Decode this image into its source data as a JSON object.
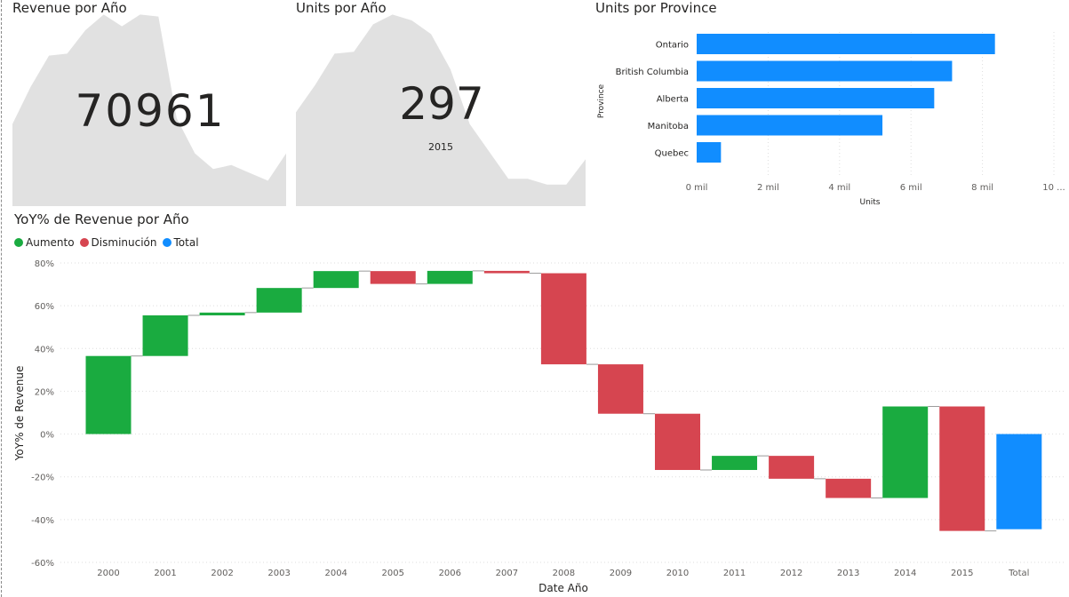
{
  "colors": {
    "increase": "#1aab40",
    "decrease": "#d64550",
    "total": "#118dff",
    "bar": "#118dff",
    "sparkline_fill": "#e1e1e1",
    "grid": "#dedede",
    "text": "#252423",
    "axis_text": "#605e5c"
  },
  "card_revenue": {
    "title": "Revenue por Año",
    "value": "70961"
  },
  "card_units": {
    "title": "Units por Año",
    "value": "297",
    "tooltip_year": "2015"
  },
  "units_by_province": {
    "title": "Units por Province"
  },
  "waterfall": {
    "title": "YoY% de Revenue por Año",
    "legend": [
      "Aumento",
      "Disminución",
      "Total"
    ]
  },
  "chart_data": [
    {
      "type": "area",
      "name": "revenue-sparkline",
      "title": "Revenue por Año",
      "x": [
        2000,
        2001,
        2002,
        2003,
        2004,
        2005,
        2006,
        2007,
        2008,
        2009,
        2010,
        2011,
        2012,
        2013,
        2014,
        2015
      ],
      "values": [
        0.42,
        0.61,
        0.77,
        0.78,
        0.9,
        0.98,
        0.92,
        0.98,
        0.97,
        0.45,
        0.27,
        0.19,
        0.21,
        0.17,
        0.13,
        0.27
      ],
      "value_scale": "relative",
      "axes_visible": false
    },
    {
      "type": "area",
      "name": "units-sparkline",
      "title": "Units por Año",
      "x": [
        2000,
        2001,
        2002,
        2003,
        2004,
        2005,
        2006,
        2007,
        2008,
        2009,
        2010,
        2011,
        2012,
        2013,
        2014,
        2015
      ],
      "values": [
        0.48,
        0.62,
        0.78,
        0.79,
        0.93,
        0.98,
        0.95,
        0.88,
        0.7,
        0.42,
        0.28,
        0.14,
        0.14,
        0.11,
        0.11,
        0.24
      ],
      "value_scale": "relative",
      "axes_visible": false
    },
    {
      "type": "bar",
      "orientation": "horizontal",
      "title": "Units por Province",
      "categories": [
        "Ontario",
        "British Columbia",
        "Alberta",
        "Manitoba",
        "Quebec"
      ],
      "values": [
        8350,
        7150,
        6650,
        5200,
        680
      ],
      "xlabel": "Units",
      "ylabel": "Province",
      "xlim": [
        0,
        10000
      ],
      "xticks": [
        "0 mil",
        "2 mil",
        "4 mil",
        "6 mil",
        "8 mil",
        "10 ..."
      ],
      "grid": "vertical-dotted"
    },
    {
      "type": "waterfall",
      "title": "YoY% de Revenue por Año",
      "xlabel": "Date Año",
      "ylabel": "YoY% de Revenue",
      "ylim": [
        -60,
        80
      ],
      "yticks": [
        "80%",
        "60%",
        "40%",
        "20%",
        "0%",
        "-20%",
        "-40%",
        "-60%"
      ],
      "categories": [
        "2000",
        "2001",
        "2002",
        "2003",
        "2004",
        "2005",
        "2006",
        "2007",
        "2008",
        "2009",
        "2010",
        "2011",
        "2012",
        "2013",
        "2014",
        "2015",
        "Total"
      ],
      "values": [
        36.5,
        19.0,
        1.3,
        11.5,
        7.9,
        -6.0,
        6.1,
        -1.1,
        -42.6,
        -23.1,
        -26.3,
        6.6,
        -10.7,
        -9.0,
        42.8,
        -58.2,
        -44.5
      ],
      "kinds": [
        "increase",
        "increase",
        "increase",
        "increase",
        "increase",
        "decrease",
        "increase",
        "decrease",
        "decrease",
        "decrease",
        "decrease",
        "increase",
        "decrease",
        "decrease",
        "increase",
        "decrease",
        "total"
      ],
      "legend": [
        "Aumento",
        "Disminución",
        "Total"
      ],
      "legend_position": "top-left",
      "grid": "horizontal-dotted"
    }
  ]
}
